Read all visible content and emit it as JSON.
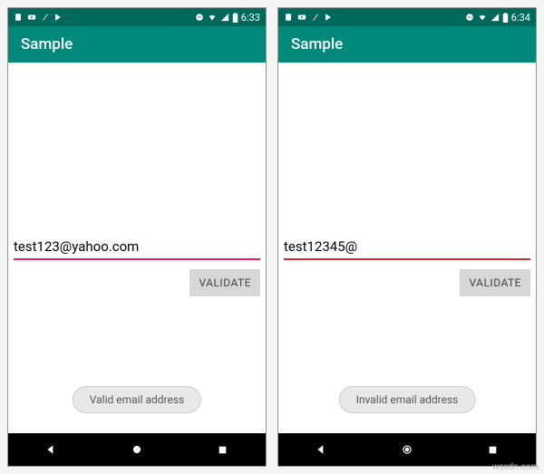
{
  "screens": [
    {
      "status": {
        "time": "6:33"
      },
      "appbar": {
        "title": "Sample"
      },
      "input": {
        "value": "test123@yahoo.com",
        "valid": true
      },
      "button": {
        "label": "VALIDATE"
      },
      "toast": {
        "message": "Valid email address"
      }
    },
    {
      "status": {
        "time": "6:34"
      },
      "appbar": {
        "title": "Sample"
      },
      "input": {
        "value": "test12345@",
        "valid": false
      },
      "button": {
        "label": "VALIDATE"
      },
      "toast": {
        "message": "Invalid email address"
      }
    }
  ],
  "watermark": "wsxdn.com"
}
